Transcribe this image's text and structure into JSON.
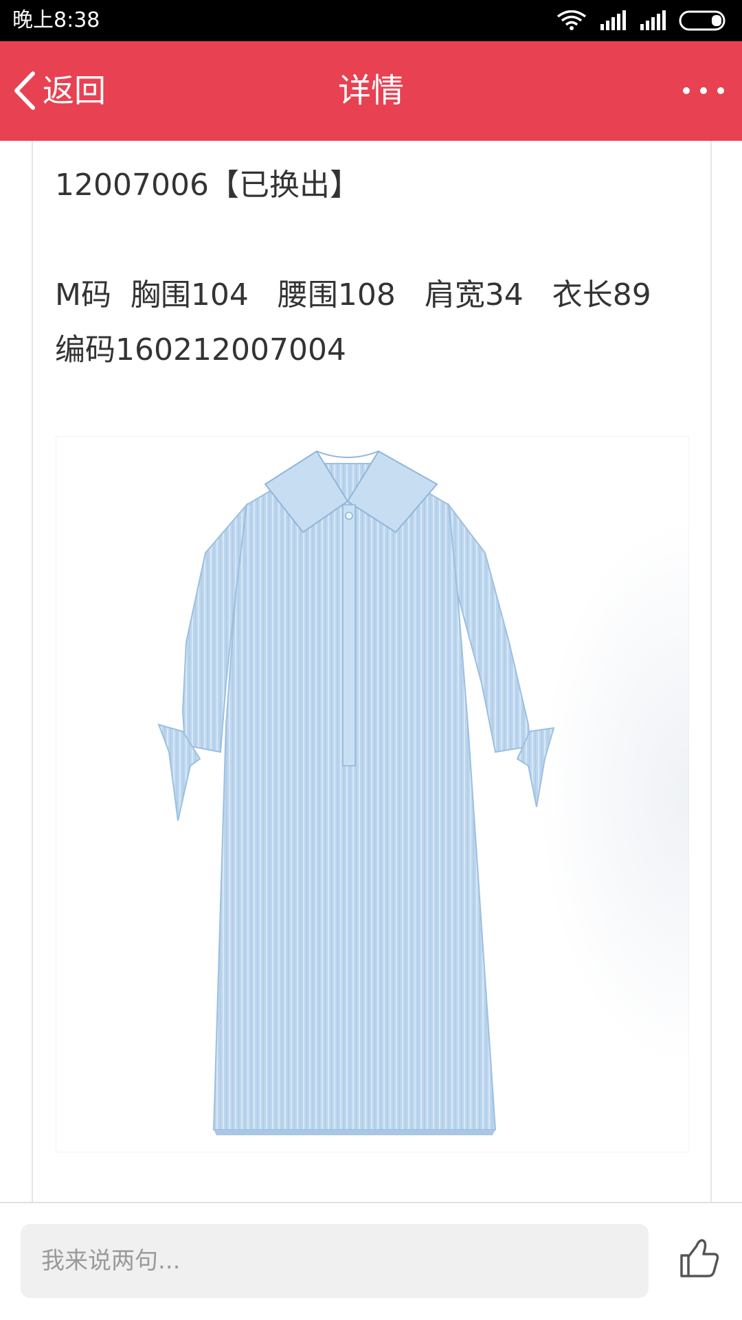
{
  "status_bar": {
    "time": "晚上8:38",
    "icons": [
      "wifi-icon",
      "signal-icon",
      "signal-icon",
      "battery-icon"
    ]
  },
  "header": {
    "back_label": "返回",
    "title": "详情",
    "more_icon": "more-icon",
    "background_color": "#e84152"
  },
  "content": {
    "line_1": "12007006【已换出】",
    "line_2": "M码  胸围104   腰围108   肩宽34   衣长89   编码160212007004",
    "image_alt": "blue striped shirt dress"
  },
  "bottom_bar": {
    "comment_placeholder": "我来说两句...",
    "like_icon": "thumbs-up-icon"
  }
}
